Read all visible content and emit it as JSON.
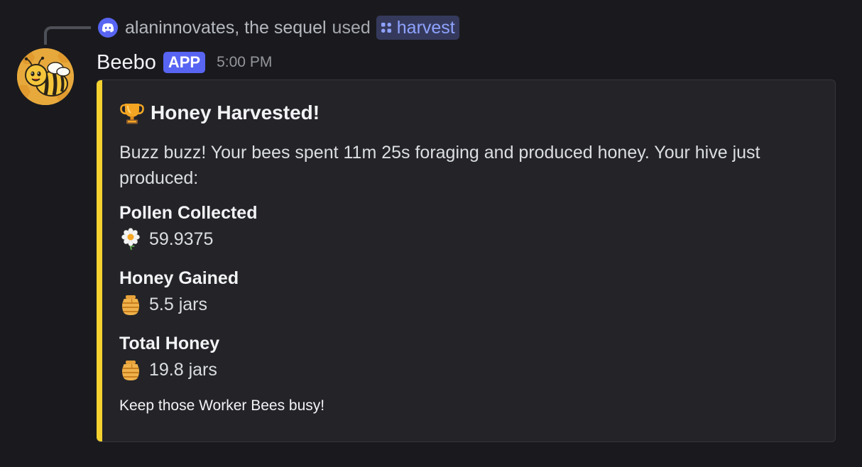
{
  "reply": {
    "user": "alaninnovates, the sequel",
    "verb": "used",
    "command": "harvest",
    "badge_icon": "discord-logo-icon",
    "command_icon": "slash-command-icon"
  },
  "message": {
    "author": "Beebo",
    "tag": "APP",
    "timestamp": "5:00 PM",
    "avatar_icon": "bee-avatar-icon"
  },
  "embed": {
    "accent_color": "#f5d230",
    "title_icon": "trophy-icon",
    "title": "Honey Harvested!",
    "description": "Buzz buzz! Your bees spent 11m 25s foraging and produced honey. Your hive just produced:",
    "fields": [
      {
        "name": "Pollen Collected",
        "icon": "daisy-flower-icon",
        "value": "59.9375"
      },
      {
        "name": "Honey Gained",
        "icon": "honey-pot-icon",
        "value": "5.5 jars"
      },
      {
        "name": "Total Honey",
        "icon": "honey-pot-icon",
        "value": "19.8 jars"
      }
    ],
    "footer": "Keep those Worker Bees busy!"
  }
}
